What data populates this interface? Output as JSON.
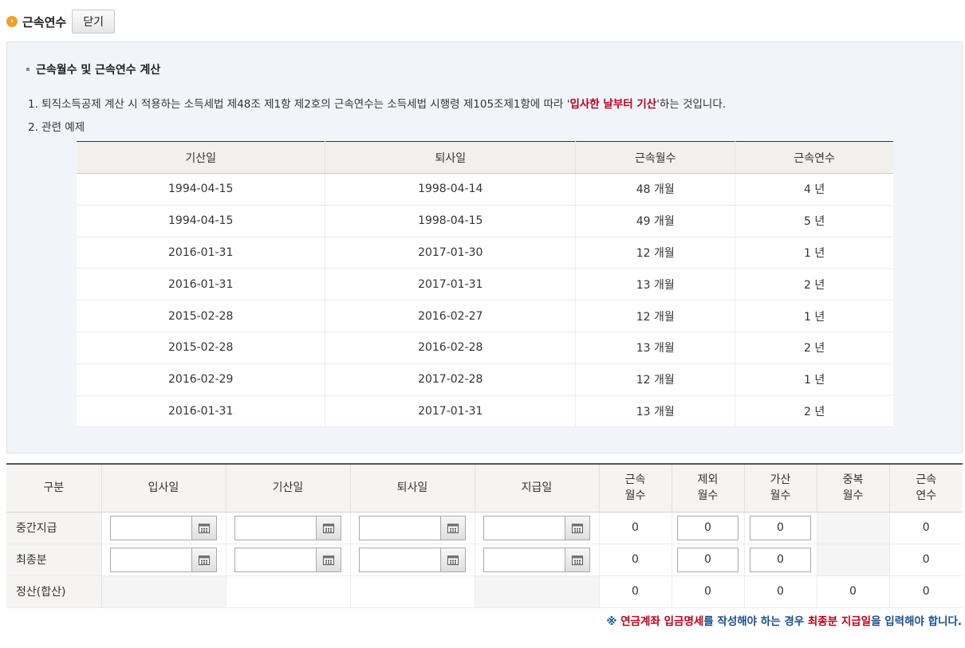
{
  "header": {
    "bullet_glyph": "›",
    "title": "근속연수",
    "close_label": "닫기"
  },
  "info": {
    "section_title": "근속월수 및 근속연수 계산",
    "line1_before": "1. 퇴직소득공제 계산 시 적용하는 소득세법 제48조 제1항 제2호의 근속연수는 소득세법 시행령 제105조제1항에 따라 '",
    "line1_highlight": "입사한 날부터 기산",
    "line1_after": "'하는 것입니다.",
    "line2": "2. 관련 예제"
  },
  "example_table": {
    "headers": [
      "기산일",
      "퇴사일",
      "근속월수",
      "근속연수"
    ],
    "rows": [
      [
        "1994-04-15",
        "1998-04-14",
        "48 개월",
        "4 년"
      ],
      [
        "1994-04-15",
        "1998-04-15",
        "49 개월",
        "5 년"
      ],
      [
        "2016-01-31",
        "2017-01-30",
        "12 개월",
        "1 년"
      ],
      [
        "2016-01-31",
        "2017-01-31",
        "13 개월",
        "2 년"
      ],
      [
        "2015-02-28",
        "2016-02-27",
        "12 개월",
        "1 년"
      ],
      [
        "2015-02-28",
        "2016-02-28",
        "13 개월",
        "2 년"
      ],
      [
        "2016-02-29",
        "2017-02-28",
        "12 개월",
        "1 년"
      ],
      [
        "2016-01-31",
        "2017-01-31",
        "13 개월",
        "2 년"
      ]
    ]
  },
  "calc_table": {
    "headers": {
      "category": "구분",
      "join_date": "입사일",
      "start_date": "기산일",
      "leave_date": "퇴사일",
      "pay_date": "지급일",
      "service_months_1": "근속",
      "service_months_2": "월수",
      "excluded_months_1": "제외",
      "excluded_months_2": "월수",
      "added_months_1": "가산",
      "added_months_2": "월수",
      "duplicate_months_1": "중복",
      "duplicate_months_2": "월수",
      "service_years_1": "근속",
      "service_years_2": "연수"
    },
    "interim": {
      "label": "중간지급",
      "join_date": "",
      "start_date": "",
      "leave_date": "",
      "pay_date": "",
      "service_months": "0",
      "excluded_months": "0",
      "added_months": "0",
      "service_years": "0"
    },
    "final": {
      "label": "최종분",
      "join_date": "",
      "start_date": "",
      "leave_date": "",
      "pay_date": "",
      "service_months": "0",
      "excluded_months": "0",
      "added_months": "0",
      "service_years": "0"
    },
    "settlement": {
      "label": "정산(합산)",
      "service_months": "0",
      "excluded_months": "0",
      "added_months": "0",
      "duplicate_months": "0",
      "service_years": "0"
    }
  },
  "notice": {
    "p1": "※ ",
    "p2": "연금계좌 입금명세",
    "p3": "를 작성해야 하는 경우 ",
    "p4": "최종분 지급일",
    "p5": "을 입력해야 합니다."
  },
  "colors": {
    "highlight_red": "#c0001a",
    "notice_blue": "#1a4f8a",
    "bullet_orange": "#f0a02a",
    "info_bg": "#f1f5fa"
  },
  "icons": {
    "header_bullet": "chevron-circle-icon",
    "date_picker": "calendar-icon"
  }
}
